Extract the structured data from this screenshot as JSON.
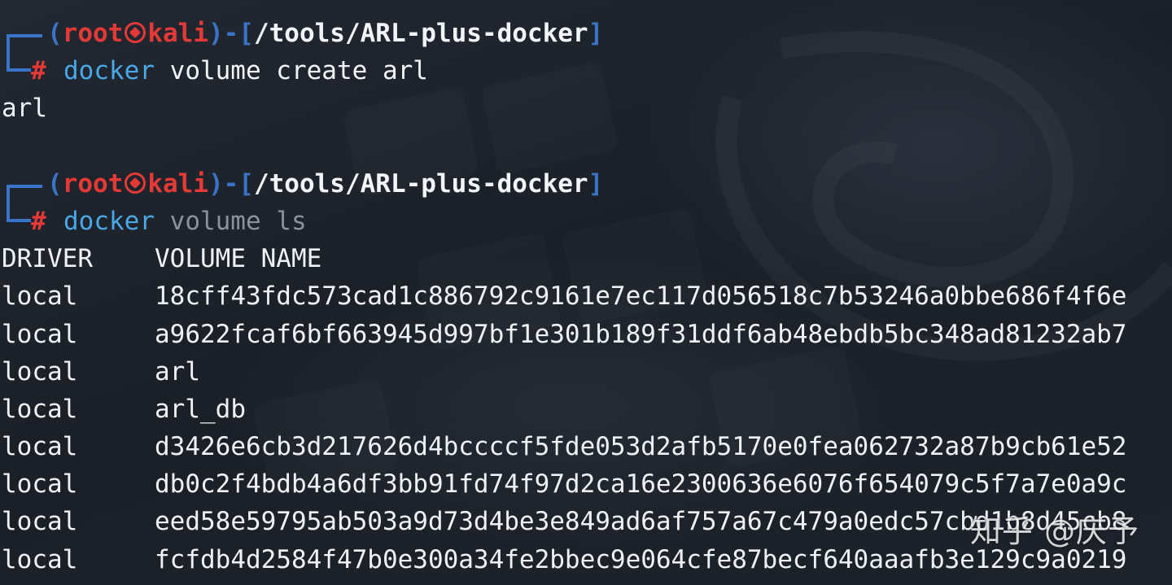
{
  "prompt": {
    "open": "(",
    "user": "root",
    "host": "kali",
    "close_mid": ")-[",
    "path": "/tools/ARL-plus-docker",
    "close": "]",
    "hash": "#"
  },
  "commands": [
    {
      "program": "docker",
      "args": "volume create arl",
      "output": [
        "arl"
      ]
    },
    {
      "program": "docker",
      "args": "volume ls",
      "output": []
    }
  ],
  "volume_table": {
    "headers": [
      "DRIVER",
      "VOLUME NAME"
    ],
    "rows": [
      {
        "driver": "local",
        "name": "18cff43fdc573cad1c886792c9161e7ec117d056518c7b53246a0bbe686f4f6e"
      },
      {
        "driver": "local",
        "name": "a9622fcaf6bf663945d997bf1e301b189f31ddf6ab48ebdb5bc348ad81232ab7"
      },
      {
        "driver": "local",
        "name": "arl"
      },
      {
        "driver": "local",
        "name": "arl_db"
      },
      {
        "driver": "local",
        "name": "d3426e6cb3d217626d4bccccf5fde053d2afb5170e0fea062732a87b9cb61e52"
      },
      {
        "driver": "local",
        "name": "db0c2f4bdb4a6df3bb91fd74f97d2ca16e2300636e6076f654079c5f7a7e0a9c"
      },
      {
        "driver": "local",
        "name": "eed58e59795ab503a9d73d4be3e849ad6af757a67c479a0edc57cbd1b8d45cb8"
      },
      {
        "driver": "local",
        "name": "fcfdb4d2584f47b0e300a34fe2bbec9e064cfe87becf640aaafb3e129c9a0219"
      }
    ]
  },
  "watermark": "知乎 @庆予",
  "colors": {
    "background": "#1c2129",
    "prompt_blue": "#3a74c9",
    "prompt_red": "#e53935",
    "command_blue": "#4aa8e8",
    "text": "#eef2f6"
  }
}
